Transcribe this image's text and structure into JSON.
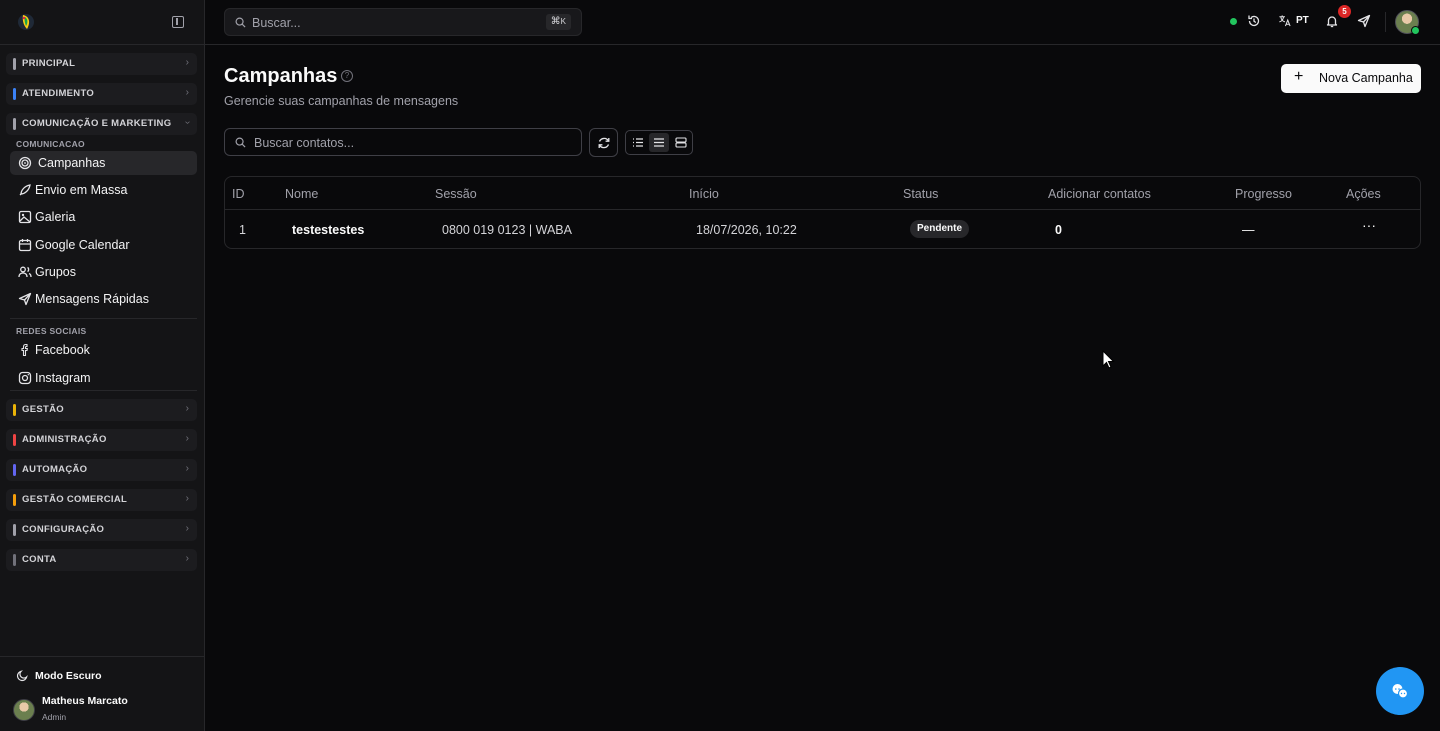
{
  "sidebar": {
    "sections_top": [
      {
        "label": "PRINCIPAL",
        "color": "#a1a1aa"
      },
      {
        "label": "ATENDIMENTO",
        "color": "#3b82f6"
      },
      {
        "label": "COMUNICAÇÃO E MARKETING",
        "color": "#a1a1aa"
      }
    ],
    "group1_title": "COMUNICACAO",
    "group1_items": [
      {
        "label": "Campanhas",
        "icon": "target-icon",
        "active": true
      },
      {
        "label": "Envio em Massa",
        "icon": "rocket-icon"
      },
      {
        "label": "Galeria",
        "icon": "image-icon"
      },
      {
        "label": "Google Calendar",
        "icon": "calendar-icon"
      },
      {
        "label": "Grupos",
        "icon": "users-icon"
      },
      {
        "label": "Mensagens Rápidas",
        "icon": "send-icon"
      }
    ],
    "group2_title": "REDES SOCIAIS",
    "group2_items": [
      {
        "label": "Facebook",
        "icon": "facebook-icon"
      },
      {
        "label": "Instagram",
        "icon": "instagram-icon"
      }
    ],
    "sections_bottom": [
      {
        "label": "GESTÃO",
        "color": "#eab308"
      },
      {
        "label": "ADMINISTRAÇÃO",
        "color": "#ef4444"
      },
      {
        "label": "AUTOMAÇÃO",
        "color": "#6366f1"
      },
      {
        "label": "GESTÃO COMERCIAL",
        "color": "#f59e0b"
      },
      {
        "label": "CONFIGURAÇÃO",
        "color": "#a1a1aa"
      },
      {
        "label": "CONTA",
        "color": "#71717a"
      }
    ],
    "dark_mode_label": "Modo Escuro",
    "user_name": "Matheus Marcato",
    "user_role": "Admin"
  },
  "topbar": {
    "search_placeholder": "Buscar...",
    "shortcut_symbol": "⌘",
    "shortcut_key": "K",
    "language": "PT",
    "notification_count": "5"
  },
  "main": {
    "title": "Campanhas",
    "subtitle": "Gerencie suas campanhas de mensagens",
    "new_button": "Nova Campanha",
    "contact_search_placeholder": "Buscar contatos..."
  },
  "table": {
    "headers": [
      "ID",
      "Nome",
      "Sessão",
      "Início",
      "Status",
      "Adicionar contatos",
      "Progresso",
      "Ações"
    ],
    "rows": [
      {
        "id": "1",
        "name": "testestestes",
        "session": "0800 019 0123 | WABA",
        "start": "18/07/2026, 10:22",
        "status": "Pendente",
        "contacts": "0",
        "progress": "—"
      }
    ]
  }
}
